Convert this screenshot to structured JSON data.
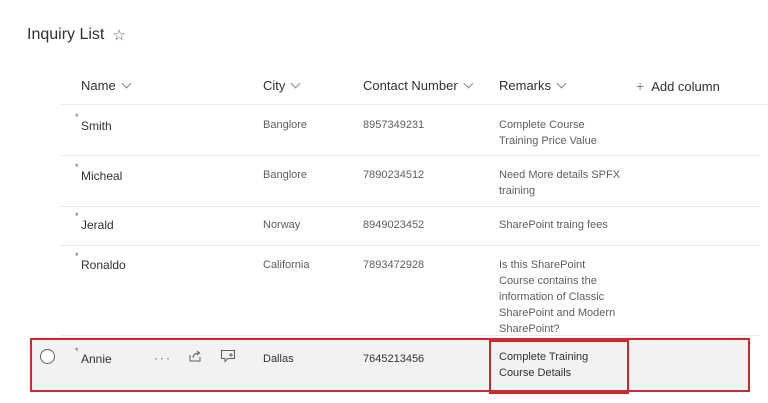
{
  "list": {
    "title": "Inquiry List",
    "favorite_icon": "star-icon"
  },
  "columns": [
    {
      "label": "Name"
    },
    {
      "label": "City"
    },
    {
      "label": "Contact Number"
    },
    {
      "label": "Remarks"
    }
  ],
  "add_column_label": "Add column",
  "rows": [
    {
      "name": "Smith",
      "city": "Banglore",
      "contact": "8957349231",
      "remarks": "Complete Course Training Price Value"
    },
    {
      "name": "Micheal",
      "city": "Banglore",
      "contact": "7890234512",
      "remarks": "Need More details SPFX training"
    },
    {
      "name": "Jerald",
      "city": "Norway",
      "contact": "8949023452",
      "remarks": "SharePoint traing fees"
    },
    {
      "name": "Ronaldo",
      "city": "California",
      "contact": "7893472928",
      "remarks": "Is this SharePoint Course contains the information of Classic SharePoint and Modern SharePoint?"
    },
    {
      "name": "Annie",
      "city": "Dallas",
      "contact": "7645213456",
      "remarks": "Complete Training Course Details"
    }
  ],
  "selected_row_actions": [
    "more-options-icon",
    "share-icon",
    "comment-icon"
  ],
  "highlight_color": "#d0262d"
}
